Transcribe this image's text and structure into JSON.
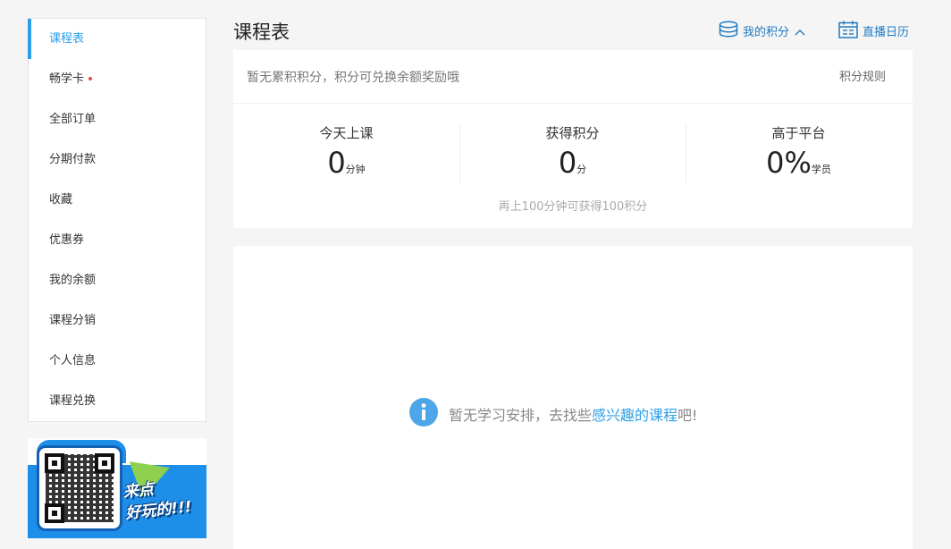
{
  "sidebar": {
    "items": [
      {
        "label": "课程表"
      },
      {
        "label": "畅学卡"
      },
      {
        "label": "全部订单"
      },
      {
        "label": "分期付款"
      },
      {
        "label": "收藏"
      },
      {
        "label": "优惠券"
      },
      {
        "label": "我的余额"
      },
      {
        "label": "课程分销"
      },
      {
        "label": "个人信息"
      },
      {
        "label": "课程兑换"
      }
    ]
  },
  "promo": {
    "line1": "来点",
    "line2": "好玩的!!!"
  },
  "header": {
    "title": "课程表",
    "points_link": "我的积分",
    "calendar_link": "直播日历"
  },
  "points": {
    "tip": "暂无累积积分，积分可兑换余额奖励哦",
    "rules": "积分规则",
    "stats": [
      {
        "label": "今天上课",
        "value": "0",
        "unit": "分钟"
      },
      {
        "label": "获得积分",
        "value": "0",
        "unit": "分"
      },
      {
        "label": "高于平台",
        "value": "0%",
        "unit": "学员"
      }
    ],
    "hint": "再上100分钟可获得100积分"
  },
  "empty": {
    "text_before": "暂无学习安排，去找些",
    "link": "感兴趣的课程",
    "text_after": "吧!"
  },
  "colors": {
    "accent": "#2d9fe8",
    "link": "#1f7ac2",
    "badge": "#e84545",
    "promo_bg": "#1e8fe8"
  }
}
